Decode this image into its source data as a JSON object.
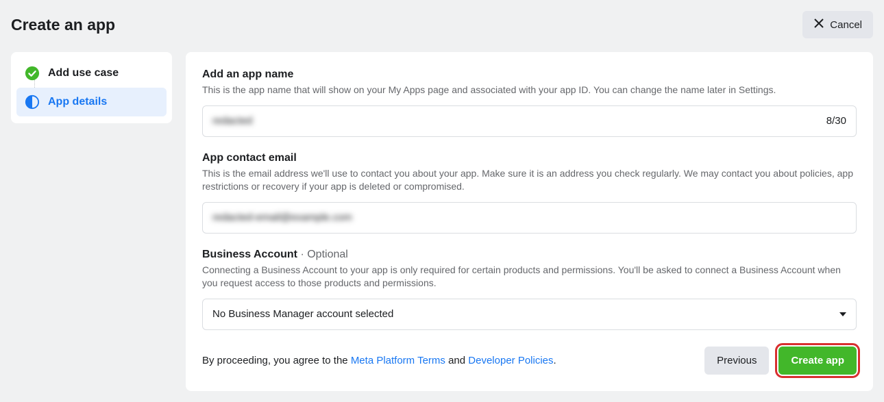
{
  "header": {
    "title": "Create an app",
    "cancel_label": "Cancel"
  },
  "sidebar": {
    "steps": [
      {
        "label": "Add use case",
        "status": "complete"
      },
      {
        "label": "App details",
        "status": "current"
      }
    ]
  },
  "form": {
    "app_name": {
      "label": "Add an app name",
      "desc": "This is the app name that will show on your My Apps page and associated with your app ID. You can change the name later in Settings.",
      "value": "redacted",
      "counter": "8/30"
    },
    "contact_email": {
      "label": "App contact email",
      "desc": "This is the email address we'll use to contact you about your app. Make sure it is an address you check regularly. We may contact you about policies, app restrictions or recovery if your app is deleted or compromised.",
      "value": "redacted-email@example.com"
    },
    "business_account": {
      "label": "Business Account",
      "optional_text": " · Optional",
      "desc": "Connecting a Business Account to your app is only required for certain products and permissions. You'll be asked to connect a Business Account when you request access to those products and permissions.",
      "selected": "No Business Manager account selected"
    }
  },
  "footer": {
    "terms_prefix": "By proceeding, you agree to the ",
    "terms_link1": "Meta Platform Terms",
    "terms_mid": " and ",
    "terms_link2": "Developer Policies",
    "terms_suffix": ".",
    "previous_label": "Previous",
    "create_label": "Create app"
  }
}
